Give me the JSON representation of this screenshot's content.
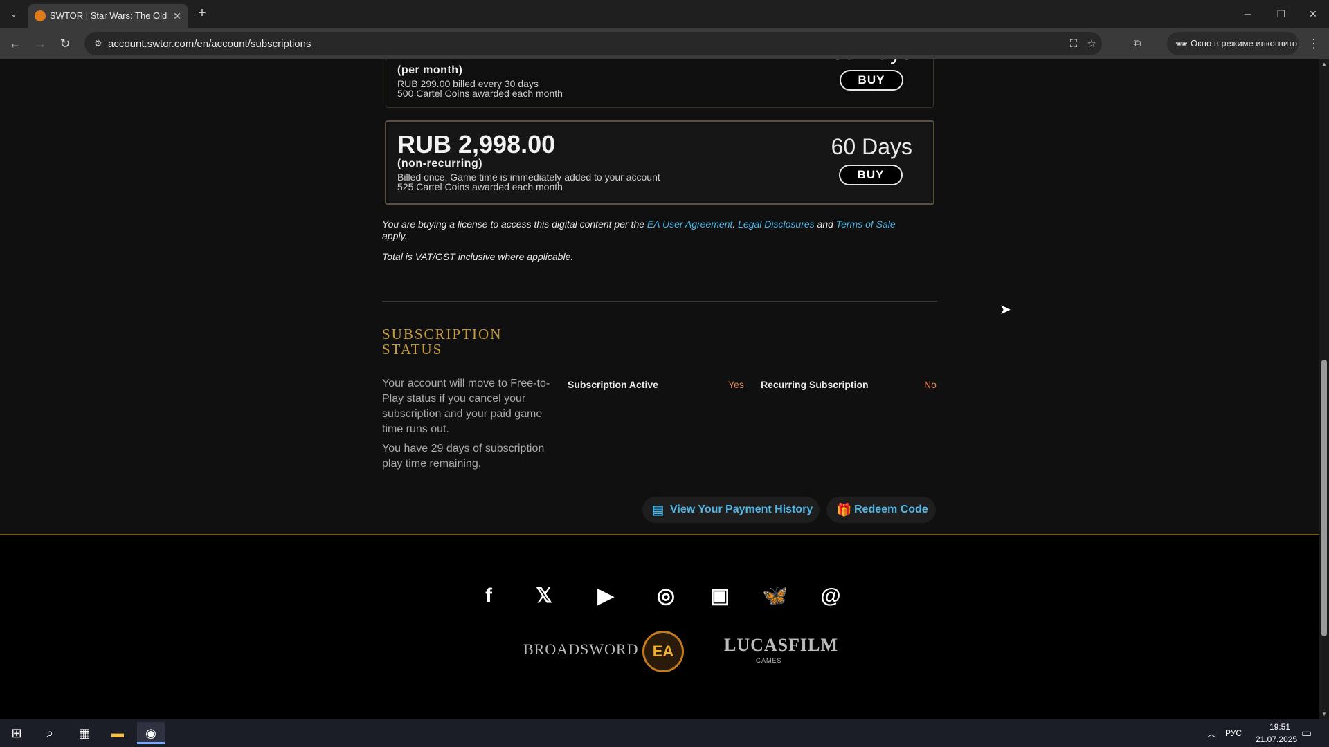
{
  "browser": {
    "tab_title": "SWTOR | Star Wars: The Old Rep",
    "url": "account.swtor.com/en/account/subscriptions",
    "incognito_label": "Окно в режиме инкогнито"
  },
  "plans": [
    {
      "price": "",
      "type": "(per month)",
      "line1": "RUB 299.00 billed every 30 days",
      "line2": "500 Cartel Coins awarded each month",
      "days": "",
      "buy_label": "BUY"
    },
    {
      "price": "RUB 2,998.00",
      "type": "(non-recurring)",
      "line1": "Billed once, Game time is immediately added to your account",
      "line2": "525 Cartel Coins awarded each month",
      "days": "60 Days",
      "buy_label": "BUY"
    }
  ],
  "legal": {
    "text1": "You are buying a license to access this digital content per the ",
    "link1": "EA User Agreement",
    "sep": ". ",
    "link2": "Legal Disclosures",
    "and": " and ",
    "link3": "Terms of Sale",
    "text2": "apply.",
    "vat": "Total is VAT/GST inclusive where applicable."
  },
  "status": {
    "title_line1": "SUBSCRIPTION",
    "title_line2": "STATUS",
    "info": "Your account will move to Free-to-Play status if you cancel your subscription and your paid game time runs out.",
    "remaining": "You have 29 days of subscription play time remaining.",
    "active_label": "Subscription Active",
    "active_value": "Yes",
    "recurring_label": "Recurring Subscription",
    "recurring_value": "No"
  },
  "actions": {
    "payment_history": "View Your Payment History",
    "redeem": "Redeem Code"
  },
  "footer": {
    "socials": [
      "facebook-icon",
      "x-icon",
      "youtube-icon",
      "instagram-icon",
      "twitch-icon",
      "bluesky-icon",
      "threads-icon"
    ],
    "partners": [
      "BROADSWORD",
      "EA",
      "LUCASFILM",
      "GAMES"
    ]
  },
  "taskbar": {
    "lang": "РУС",
    "time": "19:51",
    "date": "21.07.2025"
  },
  "colors": {
    "accent_gold": "#c89b3c",
    "link_blue": "#4fb7e8",
    "status_orange": "#e8885a"
  }
}
